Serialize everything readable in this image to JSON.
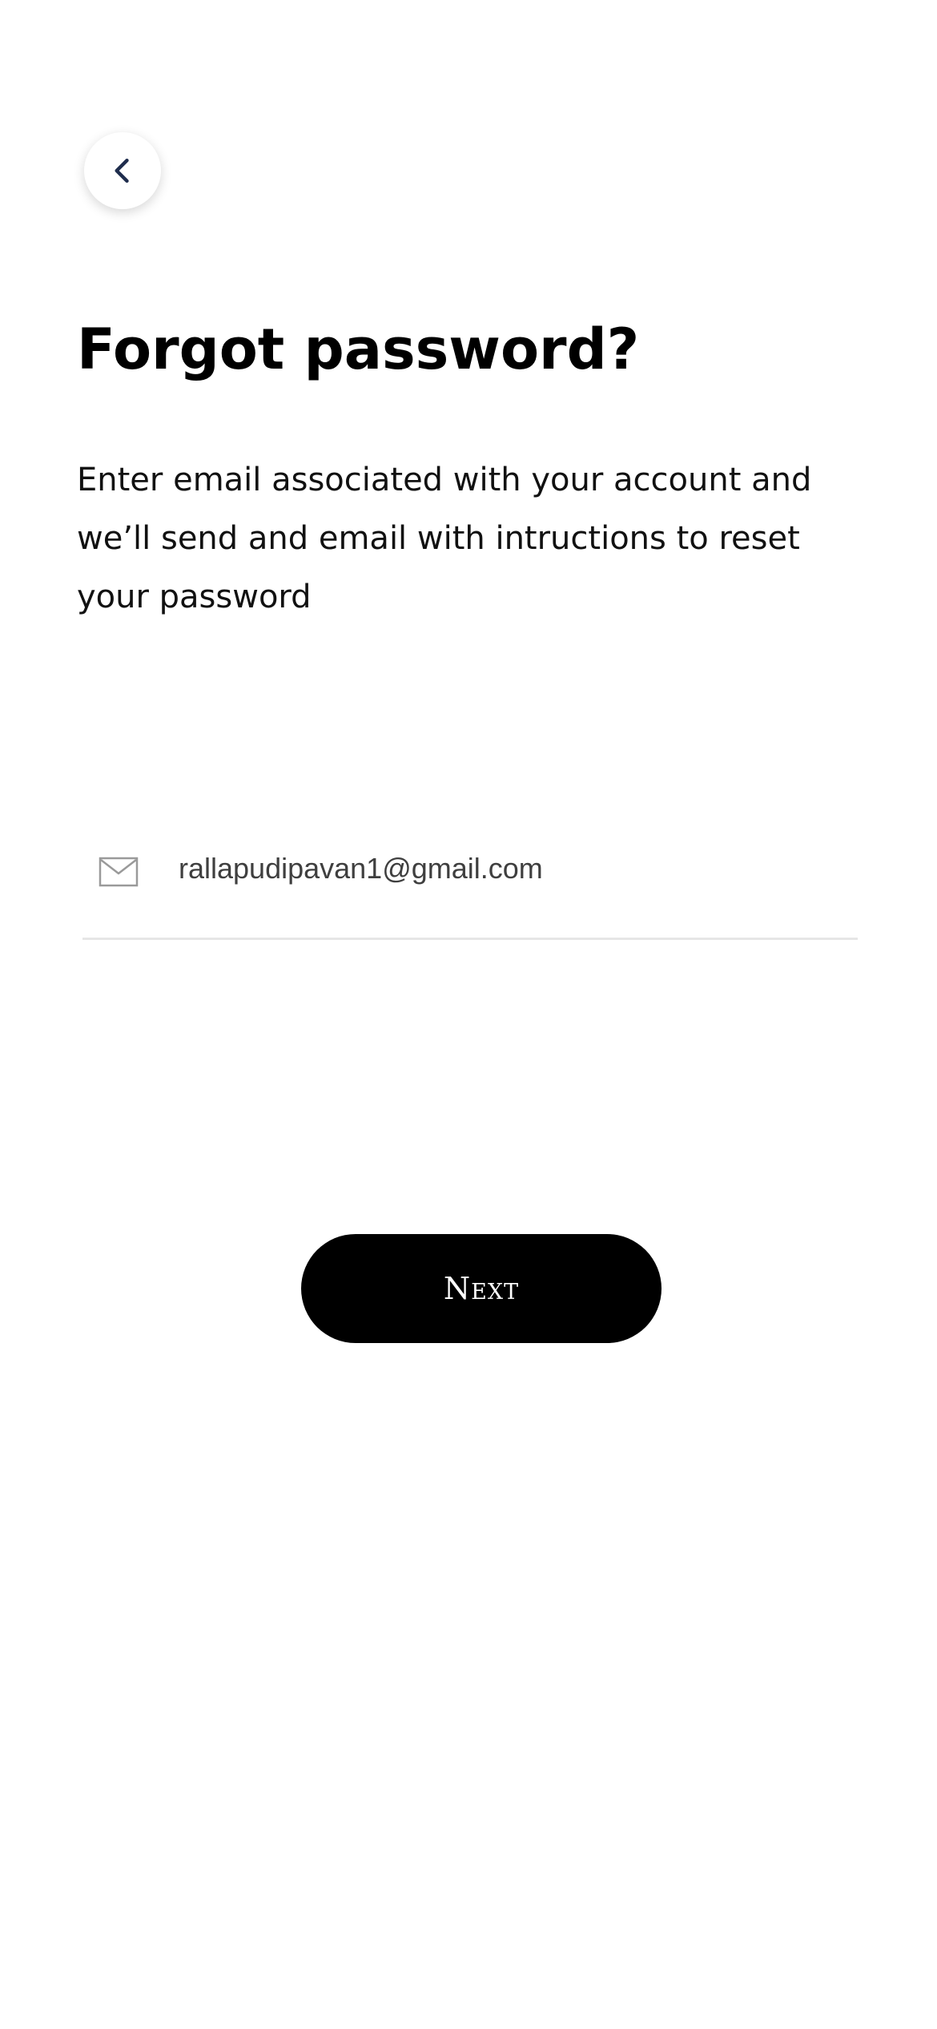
{
  "header": {
    "back_icon": "chevron-left-icon",
    "back_icon_color": "#1f2d4d"
  },
  "main": {
    "title": "Forgot password?",
    "description": "Enter email associated with your account and we’ll send and email with intructions to reset your password",
    "email_field": {
      "icon": "mail-icon",
      "value": "rallapudipavan1@gmail.com"
    },
    "next_button_label": "Next",
    "next_button_color": "#000000"
  }
}
